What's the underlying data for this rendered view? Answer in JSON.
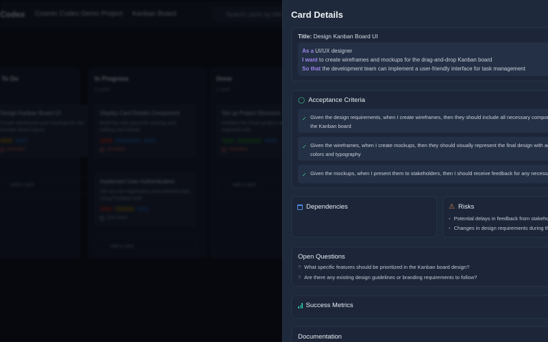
{
  "background": {
    "brand": "Codex",
    "breadcrumb": [
      "Cosmic Codex Demo Project",
      "Kanban Board"
    ],
    "search_placeholder": "Search cards by title",
    "columns": [
      {
        "title": "To Do",
        "count": "2 cards",
        "cards": [
          {
            "title": "Design Kanban Board UI",
            "desc": "Create wireframes and mockups for the Kanban board layout",
            "due": "Overdue"
          }
        ],
        "add": "Add a card"
      },
      {
        "title": "In Progress",
        "count": "2 cards",
        "cards": [
          {
            "title": "Display Card Details Component",
            "desc": "Build the side panel for viewing and editing card details",
            "due": "Overdue"
          },
          {
            "title": "Implement User Authentication",
            "desc": "Set up user registration and authentication using Firebase Auth",
            "due": "Due soon"
          }
        ],
        "add": "Add a card"
      },
      {
        "title": "Done",
        "count": "1 card",
        "cards": [
          {
            "title": "Set up Project Structure",
            "desc": "Initialize the React project with the required tools",
            "due": "Overdue"
          }
        ],
        "add": "Add a card"
      }
    ]
  },
  "panel": {
    "title": "Card Details",
    "story": {
      "title_label": "Title:",
      "title_value": "Design Kanban Board UI",
      "as_a_kw": "As a",
      "as_a": "UI/UX designer",
      "i_want_kw": "I want",
      "i_want": "to create wireframes and mockups for the drag-and-drop Kanban board",
      "so_that_kw": "So that",
      "so_that": "the development team can implement a user-friendly interface for task management"
    },
    "acceptance": {
      "heading": "Acceptance Criteria",
      "items": [
        "Given the design requirements, when I create wireframes, then they should include all necessary components of the Kanban board",
        "Given the wireframes, when I create mockups, then they should visually represent the final design with accurate colors and typography",
        "Given the mockups, when I present them to stakeholders, then I should receive feedback for any necessary changes"
      ]
    },
    "dependencies": {
      "heading": "Dependencies"
    },
    "risks": {
      "heading": "Risks",
      "items": [
        "Potential delays in feedback from stakeholders",
        "Changes in design requirements during the process"
      ]
    },
    "open_questions": {
      "heading": "Open Questions",
      "items": [
        "What specific features should be prioritized in the Kanban board design?",
        "Are there any existing design guidelines or branding requirements to follow?"
      ]
    },
    "success_metrics": {
      "heading": "Success Metrics"
    },
    "documentation": {
      "heading": "Documentation"
    }
  },
  "colors": {
    "accent": "#9f86f0",
    "check": "#3ec48a",
    "warning": "#e08a4a",
    "calendar": "#4f8fe6",
    "metrics": "#2bb3a0"
  }
}
